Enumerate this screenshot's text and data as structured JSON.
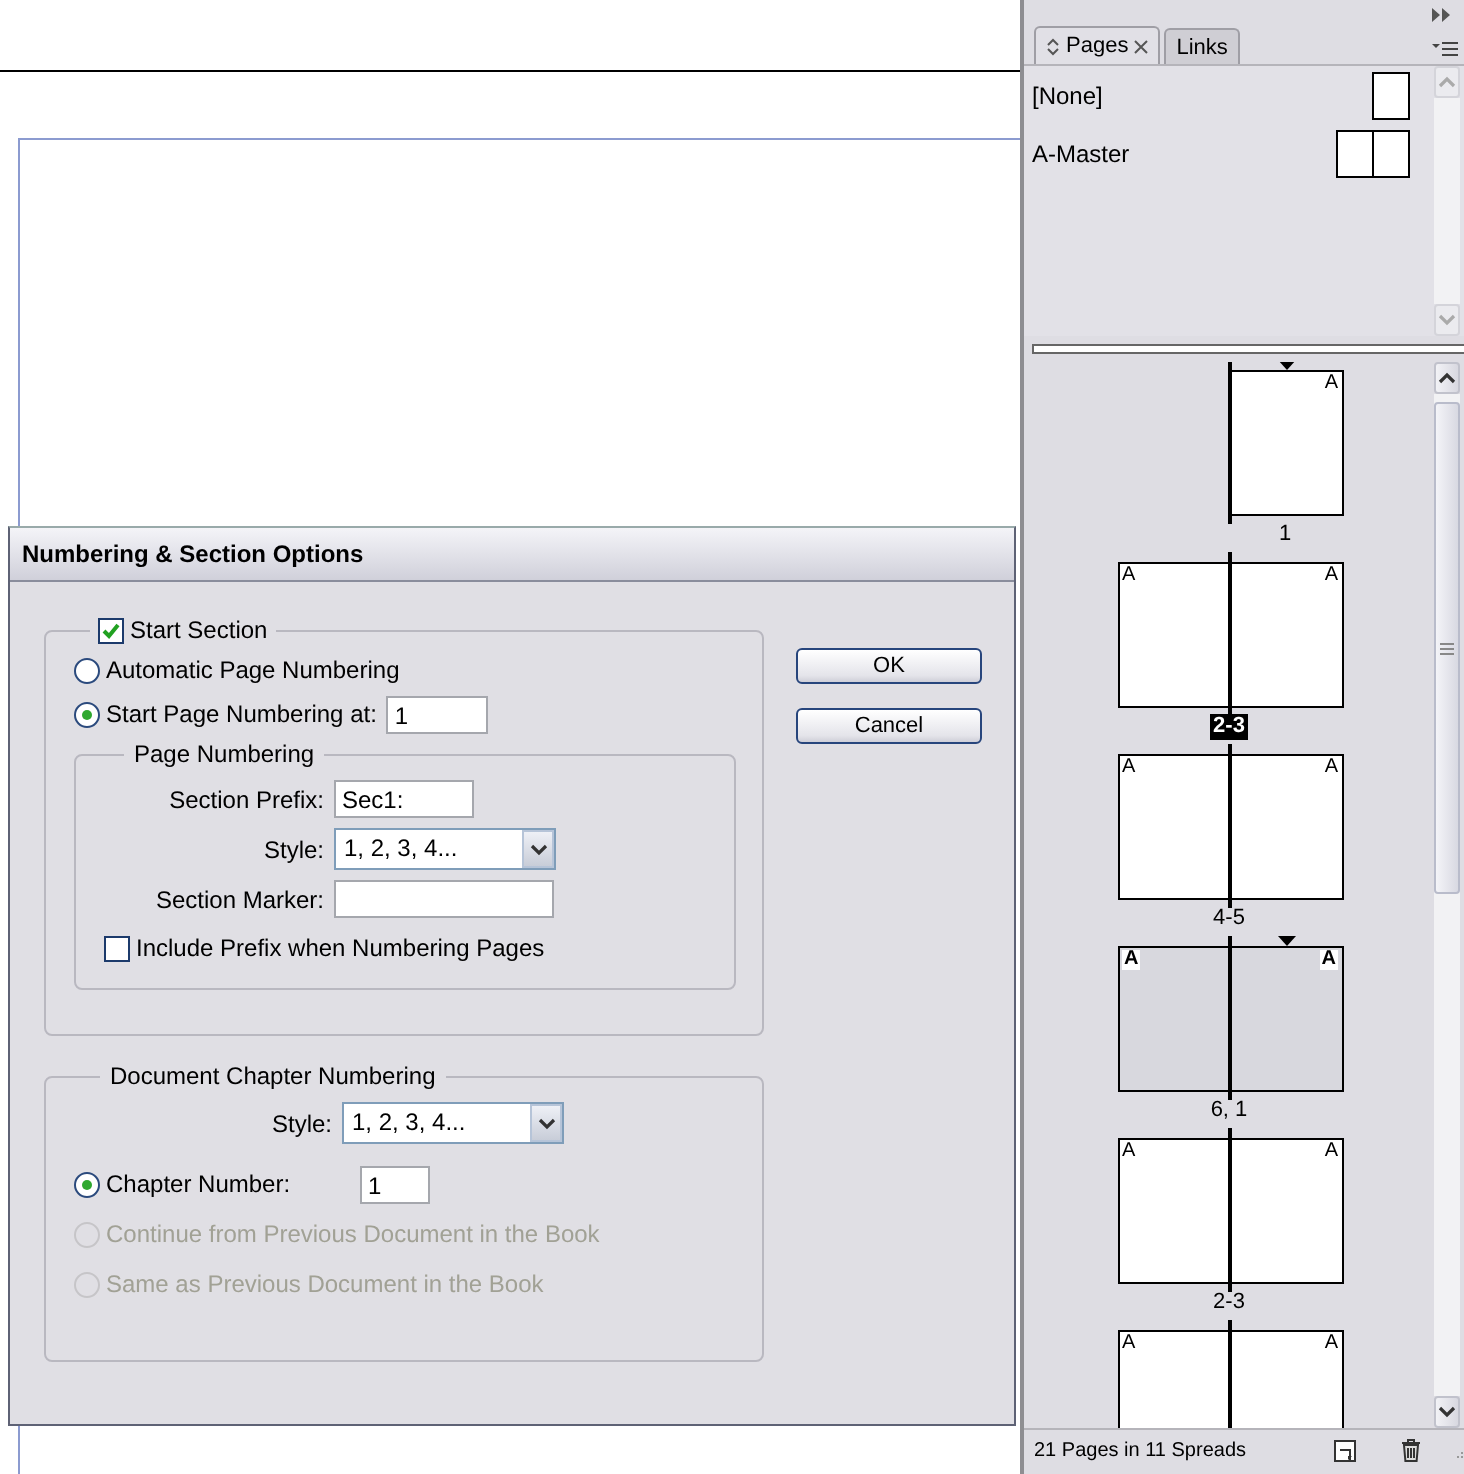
{
  "dialog": {
    "title": "Numbering & Section Options",
    "start_section": {
      "label": "Start Section",
      "checked": true
    },
    "numbering_options": [
      {
        "label": "Automatic Page Numbering",
        "selected": false
      },
      {
        "label": "Start Page Numbering at:",
        "selected": true,
        "value": "1"
      }
    ],
    "page_numbering": {
      "title": "Page Numbering",
      "section_prefix": {
        "label": "Section Prefix:",
        "value": "Sec1:"
      },
      "style": {
        "label": "Style:",
        "value": "1, 2, 3, 4..."
      },
      "section_marker": {
        "label": "Section Marker:"
      },
      "include_prefix": {
        "label": "Include Prefix when Numbering Pages",
        "checked": false
      }
    },
    "chapter_numbering": {
      "title": "Document Chapter Numbering",
      "style": {
        "label": "Style:",
        "value": "1, 2, 3, 4..."
      },
      "options": [
        {
          "label": "Chapter Number:",
          "selected": true,
          "disabled": false,
          "value": "1"
        },
        {
          "label": "Continue from Previous Document in the Book",
          "selected": false,
          "disabled": true
        },
        {
          "label": "Same as Previous Document in the Book",
          "selected": false,
          "disabled": true
        }
      ]
    },
    "buttons": [
      "OK",
      "Cancel"
    ]
  },
  "panel": {
    "tabs": [
      {
        "label": "Pages",
        "selected": true
      },
      {
        "label": "Links",
        "selected": false
      }
    ],
    "masters": [
      {
        "name": "[None]",
        "kind": "single"
      },
      {
        "name": "A-Master",
        "kind": "spread"
      }
    ],
    "spreads": [
      {
        "kind": "right-only",
        "label": "1",
        "selected": false,
        "target": false,
        "section_start": true,
        "pages": [
          {
            "master": "A"
          }
        ]
      },
      {
        "kind": "pair",
        "label": "2-3",
        "selected": false,
        "target": true,
        "section_start": false,
        "pages": [
          {
            "master": "A"
          },
          {
            "master": "A"
          }
        ]
      },
      {
        "kind": "pair",
        "label": "4-5",
        "selected": false,
        "target": false,
        "section_start": false,
        "pages": [
          {
            "master": "A"
          },
          {
            "master": "A"
          }
        ]
      },
      {
        "kind": "pair",
        "label": "6, 1",
        "selected": true,
        "target": false,
        "section_start": true,
        "pages": [
          {
            "master": "A"
          },
          {
            "master": "A"
          }
        ]
      },
      {
        "kind": "pair",
        "label": "2-3",
        "selected": false,
        "target": false,
        "section_start": false,
        "pages": [
          {
            "master": "A"
          },
          {
            "master": "A"
          }
        ]
      },
      {
        "kind": "pair",
        "selected": false,
        "section_start": false,
        "pages": [
          {
            "master": "A"
          },
          {
            "master": "A"
          }
        ]
      }
    ],
    "status": "21 Pages in 11 Spreads"
  }
}
